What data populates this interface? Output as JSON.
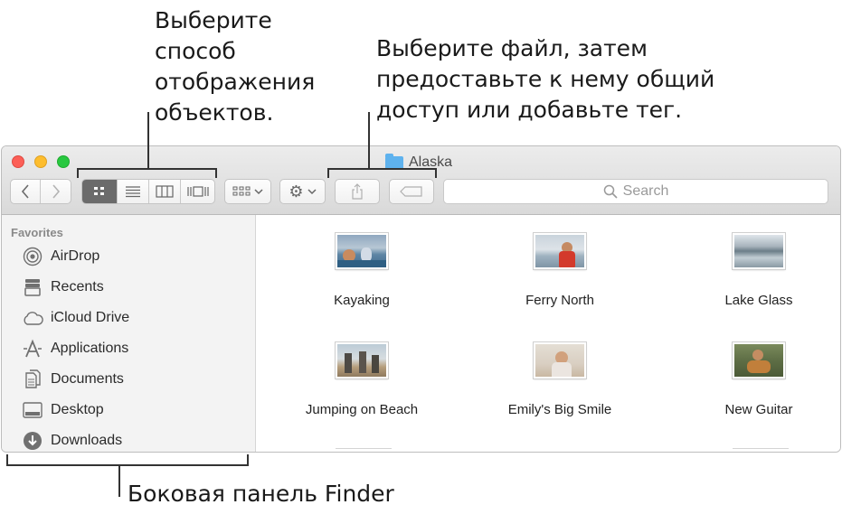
{
  "callouts": {
    "view": [
      "Выберите",
      "способ",
      "отображения",
      "объектов."
    ],
    "share": [
      "Выберите файл, затем",
      "предоставьте к нему общий",
      "доступ или добавьте тег."
    ],
    "sidebar": "Боковая панель Finder"
  },
  "window": {
    "title": "Alaska",
    "search_placeholder": "Search"
  },
  "sidebar": {
    "header": "Favorites",
    "items": [
      {
        "label": "AirDrop",
        "icon": "airdrop-icon"
      },
      {
        "label": "Recents",
        "icon": "recents-icon"
      },
      {
        "label": "iCloud Drive",
        "icon": "cloud-icon"
      },
      {
        "label": "Applications",
        "icon": "applications-icon"
      },
      {
        "label": "Documents",
        "icon": "documents-icon"
      },
      {
        "label": "Desktop",
        "icon": "desktop-icon"
      },
      {
        "label": "Downloads",
        "icon": "downloads-icon"
      }
    ]
  },
  "files": [
    {
      "name": "Kayaking"
    },
    {
      "name": "Ferry North"
    },
    {
      "name": "Lake Glass"
    },
    {
      "name": "Jumping on Beach"
    },
    {
      "name": "Emily's Big Smile"
    },
    {
      "name": "New Guitar"
    }
  ],
  "colors": {
    "close": "#fc5f57",
    "minimize": "#fdbd2e",
    "maximize": "#28c840",
    "folder": "#5eb2ee",
    "active_segment": "#6b6b6b"
  }
}
